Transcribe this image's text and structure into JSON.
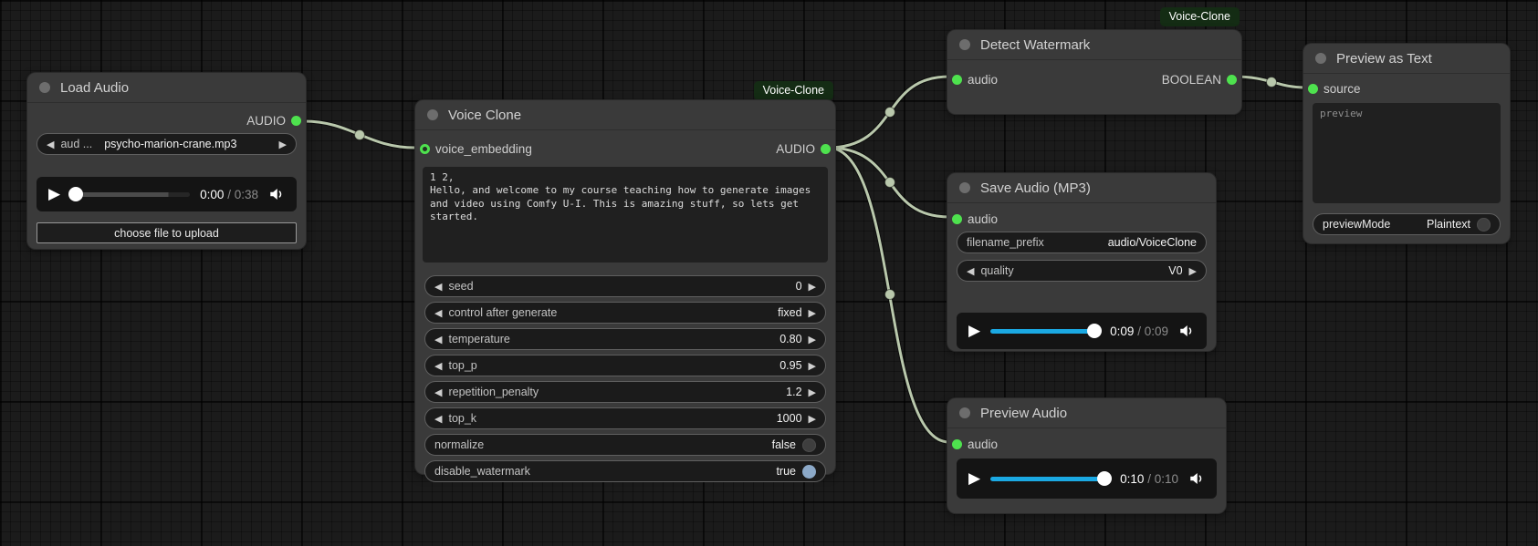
{
  "canvas": {
    "wire_color": "#b9c8ac",
    "port_green": "#4ee24e",
    "accent_blue": "#1ba9e3",
    "time_separator": "/"
  },
  "nodes": {
    "load_audio": {
      "title": "Load Audio",
      "output": "AUDIO",
      "file_combo": {
        "label": "aud ...",
        "value": "psycho-marion-crane.mp3"
      },
      "player": {
        "current": "0:00",
        "duration": "0:38"
      },
      "upload_button": "choose file to upload"
    },
    "voice_clone": {
      "title": "Voice Clone",
      "badge": "Voice-Clone",
      "input": "voice_embedding",
      "output": "AUDIO",
      "text": "1 2,\nHello, and welcome to my course teaching how to generate images and video using Comfy U-I. This is amazing stuff, so lets get started.",
      "widgets": [
        {
          "label": "seed",
          "value": "0"
        },
        {
          "label": "control after generate",
          "value": "fixed"
        },
        {
          "label": "temperature",
          "value": "0.80"
        },
        {
          "label": "top_p",
          "value": "0.95"
        },
        {
          "label": "repetition_penalty",
          "value": "1.2"
        },
        {
          "label": "top_k",
          "value": "1000"
        },
        {
          "label": "normalize",
          "value": "false"
        },
        {
          "label": "disable_watermark",
          "value": "true"
        }
      ]
    },
    "detect_watermark": {
      "title": "Detect Watermark",
      "badge": "Voice-Clone",
      "input": "audio",
      "output": "BOOLEAN"
    },
    "save_audio": {
      "title": "Save Audio (MP3)",
      "input": "audio",
      "widgets": [
        {
          "label": "filename_prefix",
          "value": "audio/VoiceClone"
        },
        {
          "label": "quality",
          "value": "V0"
        }
      ],
      "player": {
        "current": "0:09",
        "duration": "0:09"
      }
    },
    "preview_audio": {
      "title": "Preview Audio",
      "input": "audio",
      "player": {
        "current": "0:10",
        "duration": "0:10"
      }
    },
    "preview_text": {
      "title": "Preview as Text",
      "input": "source",
      "preview_placeholder": "preview",
      "widget": {
        "label": "previewMode",
        "value": "Plaintext"
      }
    }
  }
}
